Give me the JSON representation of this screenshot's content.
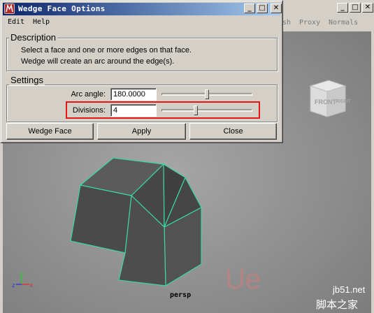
{
  "maya_window": {
    "menu_items": [
      "sh",
      "Proxy",
      "Normals"
    ],
    "view_cube": {
      "front_label": "FRONT",
      "right_label": "RIGHT"
    },
    "camera_label": "persp",
    "axis_labels": {
      "x": "x",
      "y": "y",
      "z": "z"
    }
  },
  "watermark": {
    "logo_text": "Ue",
    "site_text": "jb51.net",
    "brand_text": "脚本之家"
  },
  "dialog": {
    "title": "Wedge Face Options",
    "menu": {
      "edit": "Edit",
      "help": "Help"
    },
    "description": {
      "heading": "Description",
      "line1": "Select a face and one or more edges on that face.",
      "line2": "Wedge will create an arc around the edge(s)."
    },
    "settings": {
      "heading": "Settings",
      "arc_angle_label": "Arc angle:",
      "arc_angle_value": "180.0000",
      "arc_angle_slider_fraction": 0.5,
      "divisions_label": "Divisions:",
      "divisions_value": "4",
      "divisions_slider_fraction": 0.37
    },
    "buttons": {
      "wedge_face": "Wedge Face",
      "apply": "Apply",
      "close": "Close"
    }
  },
  "colors": {
    "highlight": "#e01818",
    "wireframe": "#3bd7a0",
    "title_bar": "#0a246a"
  }
}
